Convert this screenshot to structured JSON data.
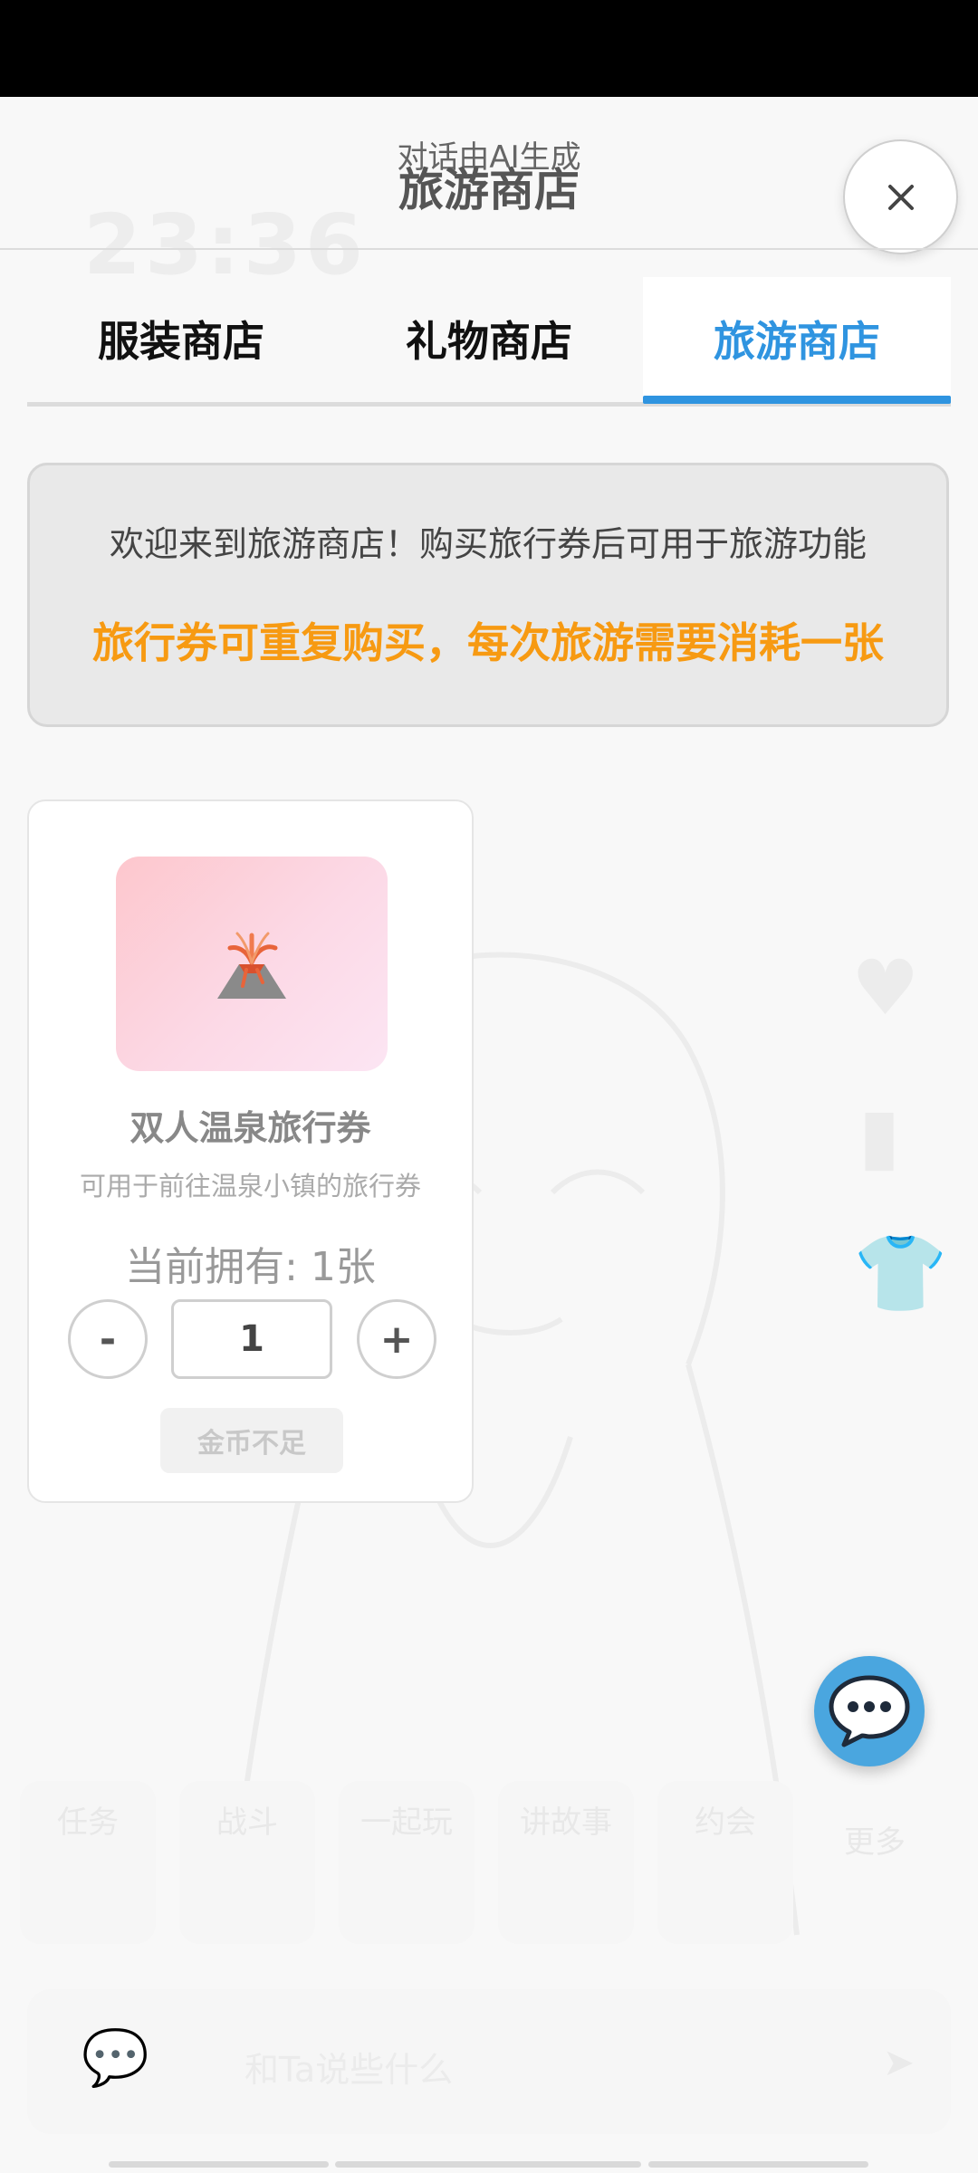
{
  "header": {
    "ai_note": "对话由AI生成",
    "title": "旅游商店"
  },
  "tabs": [
    {
      "label": "服装商店",
      "active": false
    },
    {
      "label": "礼物商店",
      "active": false
    },
    {
      "label": "旅游商店",
      "active": true
    }
  ],
  "info": {
    "line1": "欢迎来到旅游商店！购买旅行券后可用于旅游功能",
    "line2": "旅行券可重复购买，每次旅游需要消耗一张"
  },
  "product": {
    "icon": "volcano-icon",
    "name": "双人温泉旅行券",
    "description": "可用于前往温泉小镇的旅行券",
    "owned_text": "当前拥有: 1张",
    "decrement_label": "-",
    "quantity": "1",
    "increment_label": "+",
    "buy_label": "金币不足"
  },
  "background": {
    "time": "23:36",
    "actions": [
      "任务",
      "战斗",
      "一起玩",
      "讲故事",
      "约会"
    ],
    "more_label": "更多",
    "input_placeholder": "和Ta说些什么"
  },
  "colors": {
    "accent": "#2f94e0",
    "highlight": "#f79a12",
    "fab": "#4aa6df"
  }
}
